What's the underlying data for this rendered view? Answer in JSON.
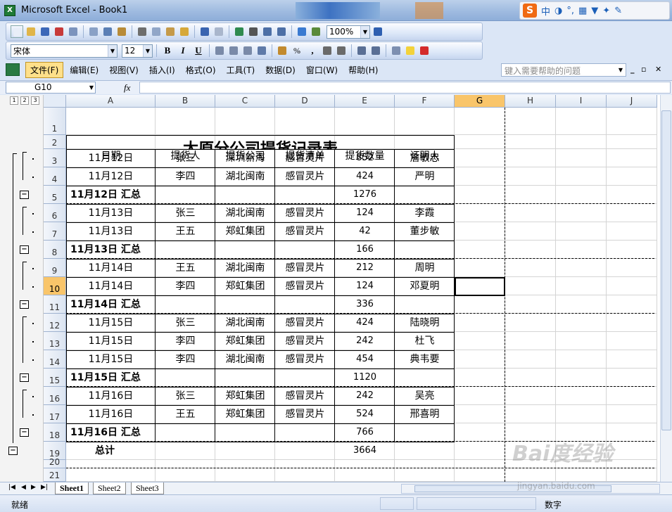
{
  "window": {
    "title": "Microsoft Excel - Book1"
  },
  "ime": {
    "mode": "中"
  },
  "toolbar": {
    "zoom": "100%",
    "font": "宋体",
    "size": "12",
    "bold": "B",
    "italic": "I",
    "underline": "U",
    "percent": "%",
    "comma": ","
  },
  "menu": {
    "items": [
      "文件(F)",
      "编辑(E)",
      "视图(V)",
      "插入(I)",
      "格式(O)",
      "工具(T)",
      "数据(D)",
      "窗口(W)",
      "帮助(H)"
    ],
    "help_placeholder": "键入需要帮助的问题"
  },
  "formula_bar": {
    "name_box": "G10",
    "fx": "fx",
    "content": ""
  },
  "outline_levels": [
    "1",
    "2",
    "3"
  ],
  "columns": [
    "A",
    "B",
    "C",
    "D",
    "E",
    "F",
    "G",
    "H",
    "I",
    "J"
  ],
  "selected_column": "G",
  "selected_row": "10",
  "rows": [
    "1",
    "2",
    "3",
    "4",
    "5",
    "6",
    "7",
    "8",
    "9",
    "10",
    "11",
    "12",
    "13",
    "14",
    "15",
    "16",
    "17",
    "18",
    "19",
    "20",
    "21"
  ],
  "sheet": {
    "title": "太原分公司提货记录表",
    "headers": [
      "日期",
      "提货人",
      "提货公司",
      "提货清单",
      "提货数量",
      "证明人"
    ],
    "data_rows": [
      [
        "11月12日",
        "张三",
        "深圳新海",
        "感冒灵片",
        "852",
        "詹敏忠"
      ],
      [
        "11月12日",
        "李四",
        "湖北闽南",
        "感冒灵片",
        "424",
        "严明"
      ],
      [
        "11月12日  汇总",
        "",
        "",
        "",
        "1276",
        ""
      ],
      [
        "11月13日",
        "张三",
        "湖北闽南",
        "感冒灵片",
        "124",
        "李霞"
      ],
      [
        "11月13日",
        "王五",
        "郑虹集团",
        "感冒灵片",
        "42",
        "董步敏"
      ],
      [
        "11月13日  汇总",
        "",
        "",
        "",
        "166",
        ""
      ],
      [
        "11月14日",
        "王五",
        "湖北闽南",
        "感冒灵片",
        "212",
        "周明"
      ],
      [
        "11月14日",
        "李四",
        "郑虹集团",
        "感冒灵片",
        "124",
        "邓夏明"
      ],
      [
        "11月14日  汇总",
        "",
        "",
        "",
        "336",
        ""
      ],
      [
        "11月15日",
        "张三",
        "湖北闽南",
        "感冒灵片",
        "424",
        "陆晓明"
      ],
      [
        "11月15日",
        "李四",
        "郑虹集团",
        "感冒灵片",
        "242",
        "杜飞"
      ],
      [
        "11月15日",
        "李四",
        "湖北闽南",
        "感冒灵片",
        "454",
        "典韦要"
      ],
      [
        "11月15日  汇总",
        "",
        "",
        "",
        "1120",
        ""
      ],
      [
        "11月16日",
        "张三",
        "郑虹集团",
        "感冒灵片",
        "242",
        "吴亮"
      ],
      [
        "11月16日",
        "王五",
        "郑虹集团",
        "感冒灵片",
        "524",
        "邢喜明"
      ],
      [
        "11月16日  汇总",
        "",
        "",
        "",
        "766",
        ""
      ],
      [
        "总计",
        "",
        "",
        "",
        "3664",
        ""
      ]
    ]
  },
  "tabs": [
    "Sheet1",
    "Sheet2",
    "Sheet3"
  ],
  "status": {
    "ready": "就绪",
    "mode": "数字"
  },
  "watermark": {
    "logo": "Bai度经验",
    "url": "jingyan.baidu.com"
  }
}
